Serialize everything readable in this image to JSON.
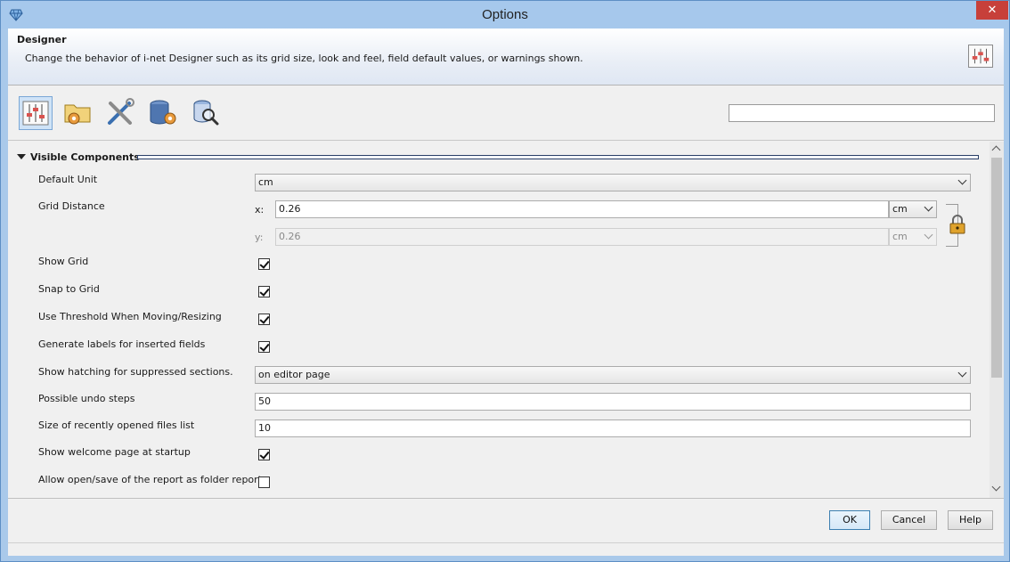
{
  "window": {
    "title": "Options"
  },
  "header": {
    "title": "Designer",
    "description": "Change the behavior of i-net Designer such as its grid size, look and feel, field default values, or warnings shown."
  },
  "toolbar": {
    "items": [
      {
        "icon": "sliders-icon",
        "selected": true
      },
      {
        "icon": "folder-gear-icon",
        "selected": false
      },
      {
        "icon": "tools-icon",
        "selected": false
      },
      {
        "icon": "database-gear-icon",
        "selected": false
      },
      {
        "icon": "search-database-icon",
        "selected": false
      }
    ],
    "search": {
      "value": "",
      "placeholder": ""
    }
  },
  "section": {
    "title": "Visible Components",
    "expanded": true
  },
  "settings": {
    "default_unit": {
      "label": "Default Unit",
      "value": "cm"
    },
    "grid_distance": {
      "label": "Grid Distance",
      "x_label": "x:",
      "x_value": "0.26",
      "x_unit": "cm",
      "y_label": "y:",
      "y_value": "0.26",
      "y_unit": "cm",
      "locked": true
    },
    "show_grid": {
      "label": "Show Grid",
      "checked": true
    },
    "snap_to_grid": {
      "label": "Snap to Grid",
      "checked": true
    },
    "use_threshold": {
      "label": "Use Threshold When Moving/Resizing",
      "checked": true
    },
    "generate_labels": {
      "label": "Generate labels for inserted fields",
      "checked": true
    },
    "show_hatching": {
      "label": "Show hatching for suppressed sections.",
      "value": "on editor page"
    },
    "undo_steps": {
      "label": "Possible undo steps",
      "value": "50"
    },
    "recent_files": {
      "label": "Size of recently opened files list",
      "value": "10"
    },
    "welcome_page": {
      "label": "Show welcome page at startup",
      "checked": true
    },
    "folder_report": {
      "label": "Allow open/save of the report as folder report",
      "checked": false
    }
  },
  "footer": {
    "ok_label": "OK",
    "cancel_label": "Cancel",
    "help_label": "Help"
  },
  "colors": {
    "title_bar": "#a6c8ec",
    "close_button": "#c7403a",
    "selection": "#cfe3f7"
  }
}
